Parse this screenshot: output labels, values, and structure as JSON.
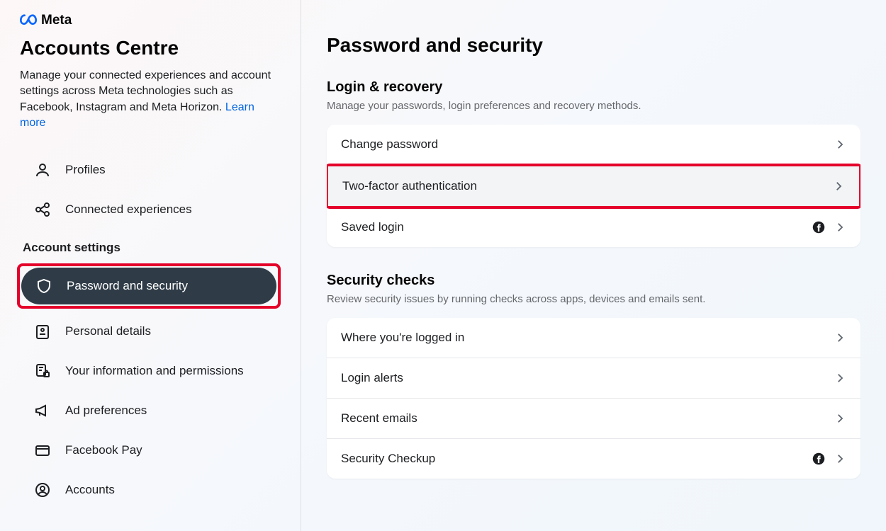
{
  "brand": {
    "name": "Meta"
  },
  "sidebar": {
    "title": "Accounts Centre",
    "description": "Manage your connected experiences and account settings across Meta technologies such as Facebook, Instagram and Meta Horizon. ",
    "learn_more": "Learn more",
    "top_items": [
      {
        "label": "Profiles"
      },
      {
        "label": "Connected experiences"
      }
    ],
    "settings_heading": "Account settings",
    "settings_items": [
      {
        "label": "Password and security"
      },
      {
        "label": "Personal details"
      },
      {
        "label": "Your information and permissions"
      },
      {
        "label": "Ad preferences"
      },
      {
        "label": "Facebook Pay"
      },
      {
        "label": "Accounts"
      }
    ]
  },
  "main": {
    "title": "Password and security",
    "sections": [
      {
        "title": "Login & recovery",
        "subtitle": "Manage your passwords, login preferences and recovery methods.",
        "rows": [
          {
            "label": "Change password"
          },
          {
            "label": "Two-factor authentication"
          },
          {
            "label": "Saved login"
          }
        ]
      },
      {
        "title": "Security checks",
        "subtitle": "Review security issues by running checks across apps, devices and emails sent.",
        "rows": [
          {
            "label": "Where you're logged in"
          },
          {
            "label": "Login alerts"
          },
          {
            "label": "Recent emails"
          },
          {
            "label": "Security Checkup"
          }
        ]
      }
    ]
  },
  "colors": {
    "highlight_border": "#e4002a",
    "active_nav": "#2f3c48",
    "link": "#0064e0"
  }
}
